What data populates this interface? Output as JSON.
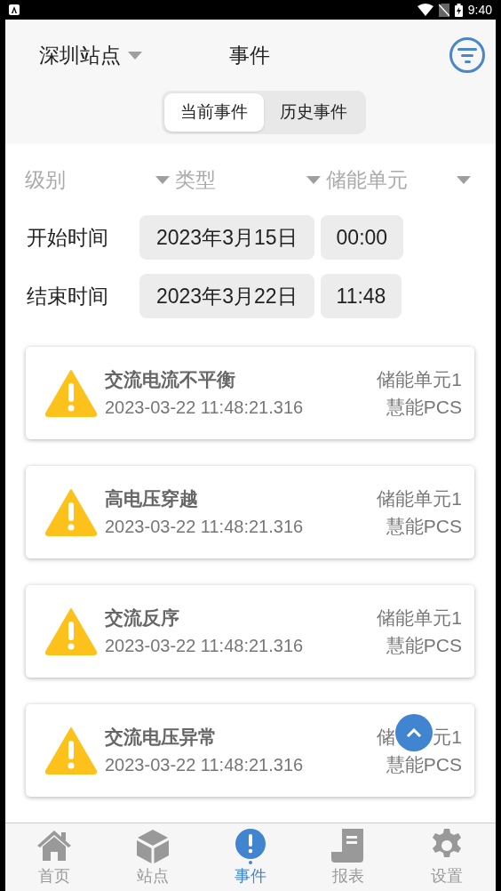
{
  "status_bar": {
    "time": "9:40"
  },
  "header": {
    "station": "深圳站点",
    "title": "事件"
  },
  "tabs": [
    {
      "label": "当前事件",
      "selected": true
    },
    {
      "label": "历史事件",
      "selected": false
    }
  ],
  "filters": [
    {
      "label": "级别"
    },
    {
      "label": "类型"
    },
    {
      "label": "储能单元"
    }
  ],
  "time_range": [
    {
      "label": "开始时间",
      "date": "2023年3月15日",
      "time": "00:00"
    },
    {
      "label": "结束时间",
      "date": "2023年3月22日",
      "time": "11:48"
    }
  ],
  "events": [
    {
      "title": "交流电流不平衡",
      "timestamp": "2023-03-22 11:48:21.316",
      "unit": "储能单元1",
      "device": "慧能PCS"
    },
    {
      "title": "高电压穿越",
      "timestamp": "2023-03-22 11:48:21.316",
      "unit": "储能单元1",
      "device": "慧能PCS"
    },
    {
      "title": "交流反序",
      "timestamp": "2023-03-22 11:48:21.316",
      "unit": "储能单元1",
      "device": "慧能PCS"
    },
    {
      "title": "交流电压异常",
      "timestamp": "2023-03-22 11:48:21.316",
      "unit_fragments": [
        "储",
        "元1"
      ],
      "device": "慧能PCS"
    }
  ],
  "nav": [
    {
      "label": "首页",
      "kind": "home",
      "selected": false
    },
    {
      "label": "站点",
      "kind": "cube",
      "selected": false
    },
    {
      "label": "事件",
      "kind": "alert",
      "selected": true
    },
    {
      "label": "报表",
      "kind": "report",
      "selected": false
    },
    {
      "label": "设置",
      "kind": "settings",
      "selected": false
    }
  ]
}
